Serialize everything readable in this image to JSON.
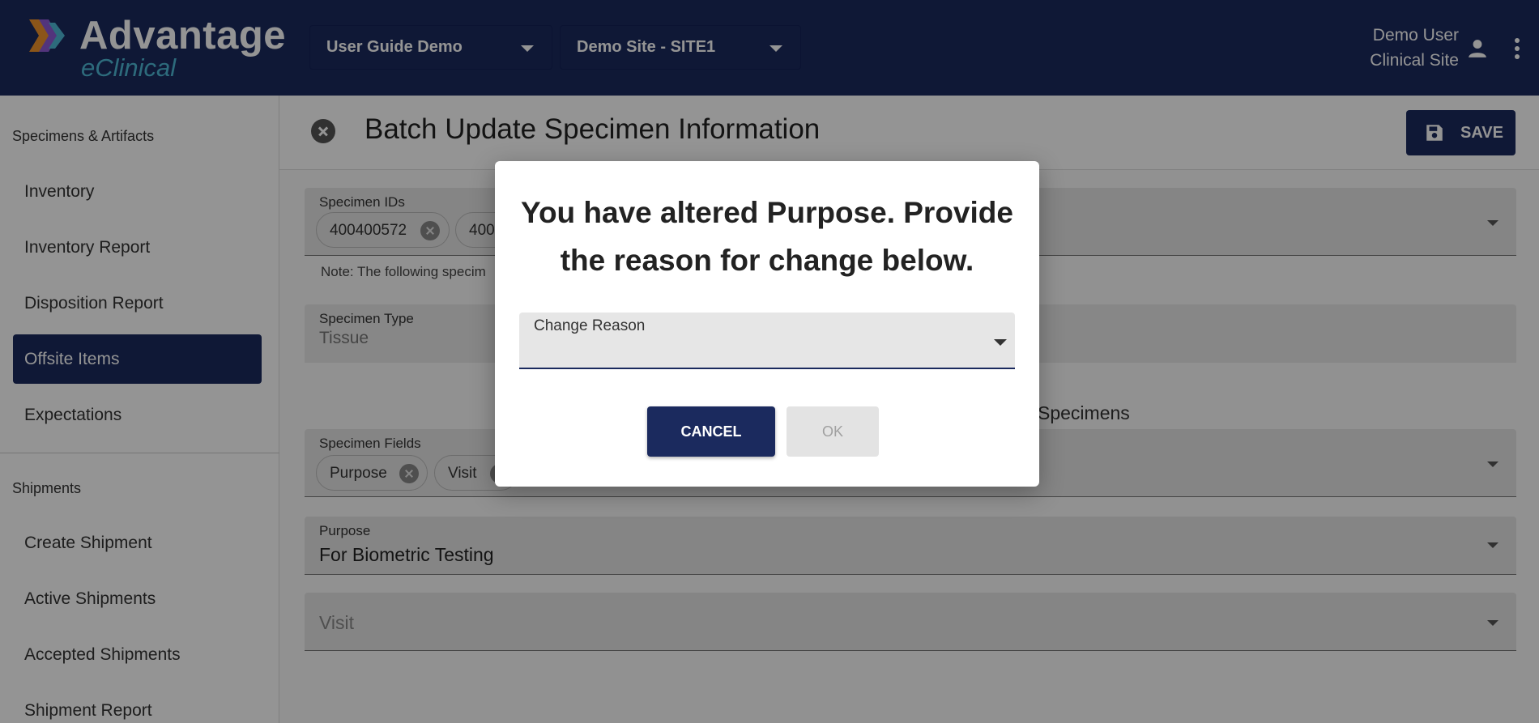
{
  "header": {
    "logo_title": "Advantage",
    "logo_subtitle": "eClinical",
    "study_select": "User Guide Demo",
    "site_select": "Demo Site - SITE1",
    "user_name": "Demo User",
    "user_role": "Clinical Site",
    "icons": [
      "logo-chevrons-icon",
      "caret-down-icon",
      "person-icon",
      "more-vert-icon"
    ]
  },
  "sidebar": {
    "sections": [
      {
        "title": "Specimens & Artifacts",
        "items": [
          {
            "label": "Inventory"
          },
          {
            "label": "Inventory Report"
          },
          {
            "label": "Disposition Report"
          },
          {
            "label": "Offsite Items",
            "active": true
          },
          {
            "label": "Expectations"
          }
        ]
      },
      {
        "title": "Shipments",
        "items": [
          {
            "label": "Create Shipment"
          },
          {
            "label": "Active Shipments"
          },
          {
            "label": "Accepted Shipments"
          },
          {
            "label": "Shipment Report"
          }
        ]
      }
    ]
  },
  "main": {
    "title": "Batch Update Specimen Information",
    "save_label": "SAVE",
    "specimen_ids": {
      "label": "Specimen IDs",
      "chips": [
        "400400572",
        "400"
      ]
    },
    "note": "Note: The following specim",
    "specimen_type": {
      "label": "Specimen Type",
      "value": "Tissue"
    },
    "section_label": "Specimens",
    "specimen_fields": {
      "label": "Specimen Fields",
      "chips": [
        "Purpose",
        "Visit"
      ]
    },
    "purpose": {
      "label": "Purpose",
      "value": "For Biometric Testing"
    },
    "visit": {
      "placeholder": "Visit"
    }
  },
  "dialog": {
    "title": "You have altered Purpose. Provide the reason for change below.",
    "field_label": "Change Reason",
    "cancel_label": "CANCEL",
    "ok_label": "OK"
  },
  "colors": {
    "brand_navy": "#1b2a5e",
    "accent_teal": "#4fb8d6",
    "logo_orange": "#f0932b",
    "logo_purple": "#8e5bd6"
  }
}
